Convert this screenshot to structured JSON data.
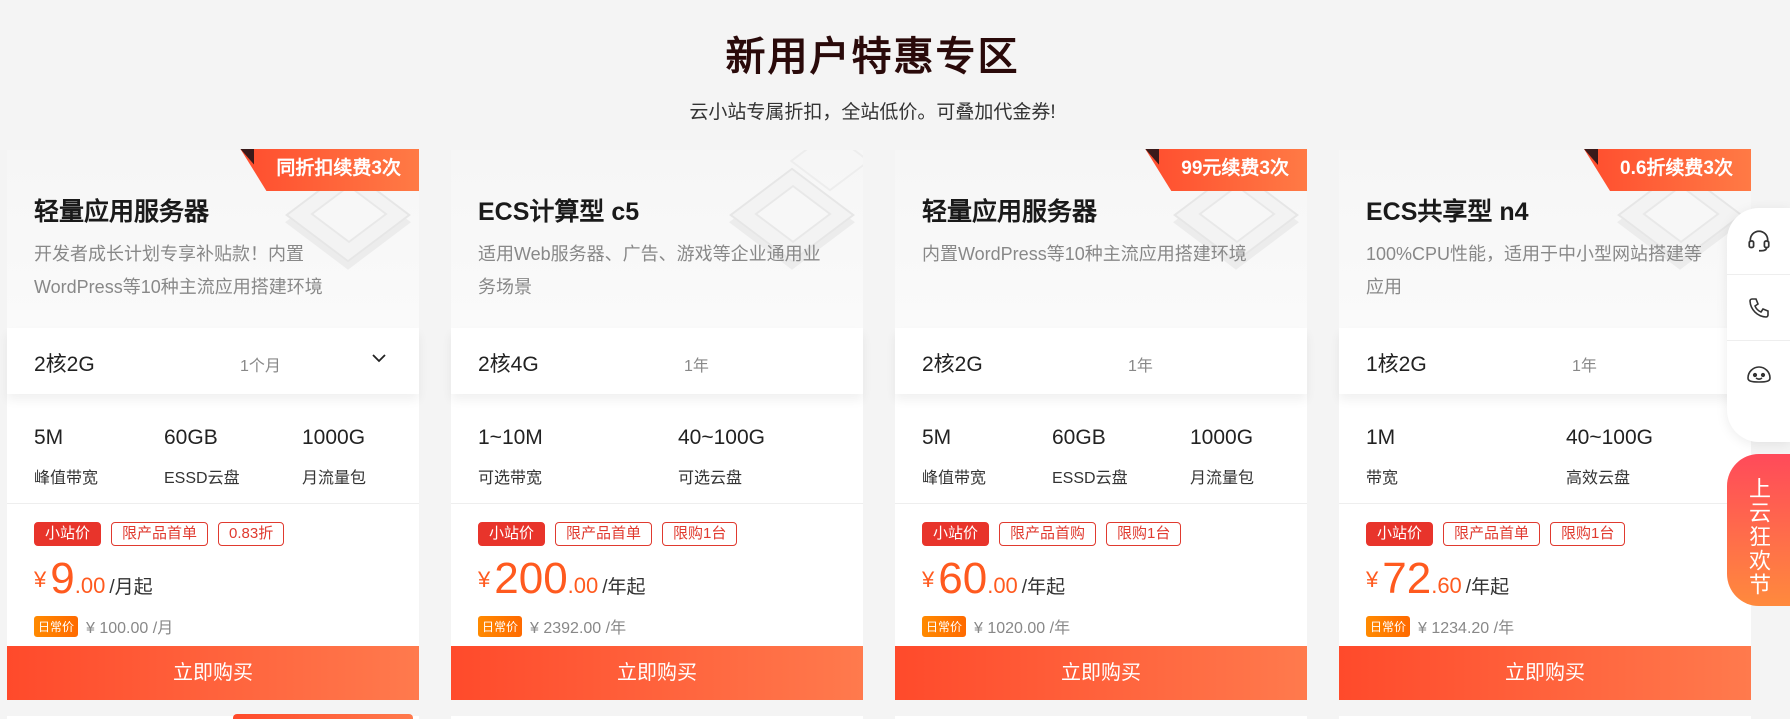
{
  "header": {
    "title": "新用户特惠专区",
    "subtitle": "云小站专属折扣，全站低价。可叠加代金券!"
  },
  "cards": [
    {
      "badge": "同折扣续费3次",
      "name": "轻量应用服务器",
      "desc": "开发者成长计划专享补贴款！内置WordPress等10种主流应用搭建环境",
      "config": "2核2G",
      "duration": "1个月",
      "has_dropdown": true,
      "features": [
        {
          "value": "5M",
          "label": "峰值带宽"
        },
        {
          "value": "60GB",
          "label": "ESSD云盘"
        },
        {
          "value": "1000G",
          "label": "月流量包"
        }
      ],
      "tags": [
        "小站价",
        "限产品首单",
        "0.83折"
      ],
      "currency": "¥",
      "price_int": "9",
      "price_dec": ".00",
      "price_unit": "/月起",
      "regular_tag": "日常价",
      "regular_price": "¥ 100.00 /月",
      "buy_label": "立即购买"
    },
    {
      "badge": "",
      "name": "ECS计算型 c5",
      "desc": "适用Web服务器、广告、游戏等企业通用业务场景",
      "config": "2核4G",
      "duration": "1年",
      "has_dropdown": false,
      "features": [
        {
          "value": "1~10M",
          "label": "可选带宽"
        },
        {
          "value": "40~100G",
          "label": "可选云盘"
        }
      ],
      "tags": [
        "小站价",
        "限产品首单",
        "限购1台"
      ],
      "currency": "¥",
      "price_int": "200",
      "price_dec": ".00",
      "price_unit": "/年起",
      "regular_tag": "日常价",
      "regular_price": "¥ 2392.00 /年",
      "buy_label": "立即购买"
    },
    {
      "badge": "99元续费3次",
      "name": "轻量应用服务器",
      "desc": "内置WordPress等10种主流应用搭建环境",
      "config": "2核2G",
      "duration": "1年",
      "has_dropdown": false,
      "features": [
        {
          "value": "5M",
          "label": "峰值带宽"
        },
        {
          "value": "60GB",
          "label": "ESSD云盘"
        },
        {
          "value": "1000G",
          "label": "月流量包"
        }
      ],
      "tags": [
        "小站价",
        "限产品首购",
        "限购1台"
      ],
      "currency": "¥",
      "price_int": "60",
      "price_dec": ".00",
      "price_unit": "/年起",
      "regular_tag": "日常价",
      "regular_price": "¥ 1020.00 /年",
      "buy_label": "立即购买"
    },
    {
      "badge": "0.6折续费3次",
      "name": "ECS共享型 n4",
      "desc": "100%CPU性能，适用于中小型网站搭建等应用",
      "config": "1核2G",
      "duration": "1年",
      "has_dropdown": false,
      "features": [
        {
          "value": "1M",
          "label": "带宽"
        },
        {
          "value": "40~100G",
          "label": "高效云盘"
        }
      ],
      "tags": [
        "小站价",
        "限产品首单",
        "限购1台"
      ],
      "currency": "¥",
      "price_int": "72",
      "price_dec": ".60",
      "price_unit": "/年起",
      "regular_tag": "日常价",
      "regular_price": "¥ 1234.20 /年",
      "buy_label": "立即购买"
    }
  ],
  "float_bar": {
    "icons": [
      "headset-icon",
      "phone-icon",
      "robot-icon"
    ],
    "promo_label": "上云狂欢节"
  },
  "colors": {
    "accent": "#ff5a1f",
    "button": "#ff4a2b",
    "tag_red": "#e03a2f"
  }
}
